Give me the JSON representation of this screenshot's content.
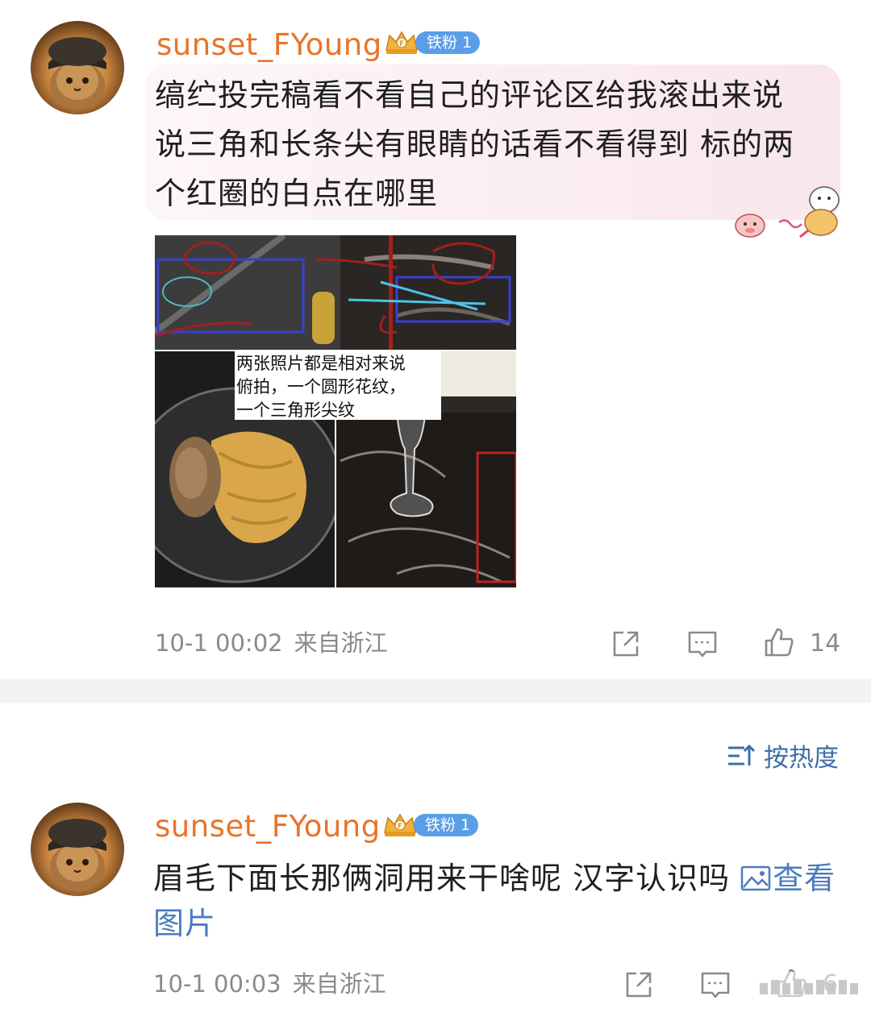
{
  "comments": [
    {
      "username": "sunset_FYoung",
      "badge": "铁粉 1",
      "text_lines": [
        "缟纻投完稿看不看自己的评论区给我滚出来说",
        "说三角和长条尖有眼睛的话看不看得到 标的两",
        "个红圈的白点在哪里"
      ],
      "image_annotation_lines": [
        "两张照片都是相对来说",
        "俯拍，一个圆形花纹，",
        "一个三角形尖纹"
      ],
      "time": "10-1 00:02",
      "location": "来自浙江",
      "like_count": "14"
    },
    {
      "username": "sunset_FYoung",
      "badge": "铁粉 1",
      "text": "眉毛下面长那俩洞用来干啥呢 汉字认识吗 ",
      "link_text": "查看图片",
      "time": "10-1 00:03",
      "location": "来自浙江",
      "like_count": "6"
    }
  ],
  "sort_label": "按热度",
  "icons": [
    "share-icon",
    "comment-icon",
    "like-icon",
    "sort-icon",
    "image-icon",
    "crown-badge-icon"
  ],
  "colors": {
    "username": "#e8742a",
    "badge": "#5b9ee8",
    "link": "#4b7bbf",
    "meta": "#8a8a8a"
  }
}
